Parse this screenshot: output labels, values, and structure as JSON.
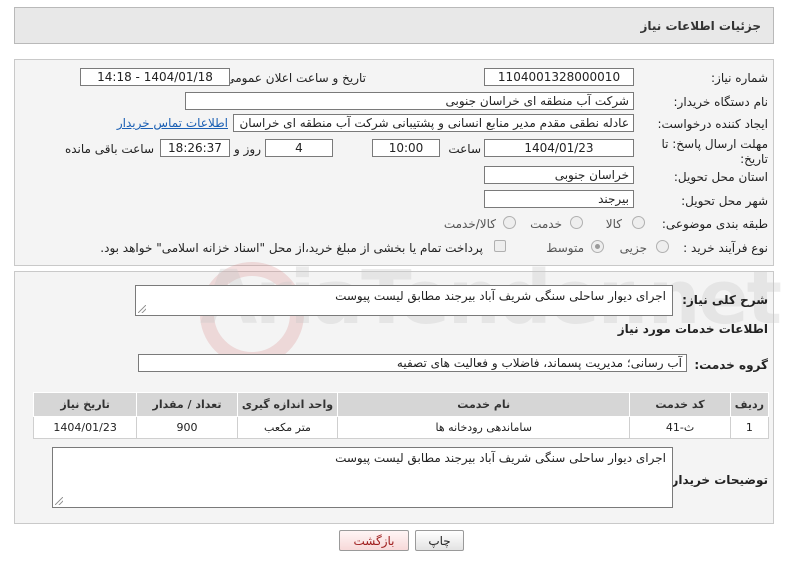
{
  "header": {
    "title": "جزئیات اطلاعات نیاز"
  },
  "form": {
    "need_number_label": "شماره نیاز:",
    "need_number": "1104001328000010",
    "announce_label": "تاریخ و ساعت اعلان عمومی:",
    "announce_value": "1404/01/18 - 14:18",
    "buyer_org_label": "نام دستگاه خریدار:",
    "buyer_org": "شرکت آب منطقه ای خراسان جنوبی",
    "creator_label": "ایجاد کننده درخواست:",
    "creator": "عادله نطقی مقدم مدیر منابع انسانی و پشتیبانی شرکت آب منطقه ای خراسان",
    "contact_link": "اطلاعات تماس خریدار",
    "deadline_label": "مهلت ارسال پاسخ: تا تاریخ:",
    "deadline_date": "1404/01/23",
    "time_label": "ساعت",
    "deadline_time": "10:00",
    "days_value": "4",
    "days_label": "روز و",
    "remaining_value": "18:26:37",
    "remaining_label": "ساعت باقی مانده",
    "province_label": "استان محل تحویل:",
    "province": "خراسان جنوبی",
    "city_label": "شهر محل تحویل:",
    "city": "بیرجند",
    "category_label": "طبقه بندی موضوعی:",
    "category_options": [
      "کالا",
      "خدمت",
      "کالا/خدمت"
    ],
    "process_label": "نوع فرآیند خرید :",
    "process_options": [
      "جزیی",
      "متوسط"
    ],
    "payment_text": "پرداخت تمام یا بخشی از مبلغ خرید،از محل \"اسناد خزانه اسلامی\" خواهد بود."
  },
  "details": {
    "summary_label": "شرح کلی نیاز:",
    "summary": "اجرای دیوار ساحلی سنگی شریف آباد بیرجند مطابق لیست پیوست",
    "services_title": "اطلاعات خدمات مورد نیاز",
    "service_group_label": "گروه خدمت:",
    "service_group": "آب رسانی؛ مدیریت پسماند، فاضلاب و فعالیت های تصفیه",
    "table": {
      "headers": [
        "ردیف",
        "کد خدمت",
        "نام خدمت",
        "واحد اندازه گیری",
        "تعداد / مقدار",
        "تاریخ نیاز"
      ],
      "rows": [
        [
          "1",
          "ث-41",
          "ساماندهی رودخانه ها",
          "متر مکعب",
          "900",
          "1404/01/23"
        ]
      ]
    },
    "buyer_notes_label": "توضیحات خریدار:",
    "buyer_notes": "اجرای دیوار ساحلی سنگی شریف آباد بیرجند مطابق لیست پیوست"
  },
  "buttons": {
    "print": "چاپ",
    "back": "بازگشت"
  }
}
